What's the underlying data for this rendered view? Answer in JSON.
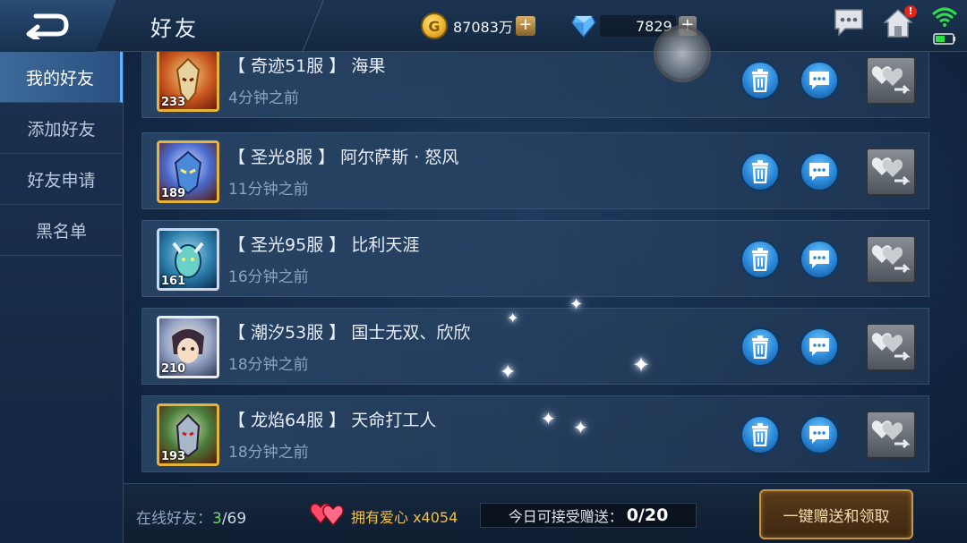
{
  "header": {
    "title": "好友",
    "gold": "87083万",
    "gold_plus": "+",
    "coin_glyph": "G",
    "diamonds": "7829",
    "diamond_plus": "+",
    "notification_badge": "!"
  },
  "sidebar": {
    "items": [
      {
        "label": "我的好友"
      },
      {
        "label": "添加好友"
      },
      {
        "label": "好友申请"
      },
      {
        "label": "黑名单"
      }
    ]
  },
  "friends": [
    {
      "server": "【 奇迹51服 】",
      "name": "海果",
      "time": "4分钟之前",
      "level": "233"
    },
    {
      "server": "【 圣光8服 】",
      "name": "阿尔萨斯 · 怒风",
      "time": "11分钟之前",
      "level": "189"
    },
    {
      "server": "【 圣光95服 】",
      "name": "比利天涯",
      "time": "16分钟之前",
      "level": "161"
    },
    {
      "server": "【 潮汐53服 】",
      "name": "国士无双、欣欣",
      "time": "18分钟之前",
      "level": "210"
    },
    {
      "server": "【 龙焰64服 】",
      "name": "天命打工人",
      "time": "18分钟之前",
      "level": "193"
    }
  ],
  "footer": {
    "online_label": "在线好友：",
    "online_count": "3",
    "online_total": "/69",
    "hearts_label": "拥有爱心 x4054",
    "gift_label": "今日可接受赠送：",
    "gift_count": "0/20",
    "claim_button": "一键赠送和领取"
  },
  "colors": {
    "accent": "#66b2ff",
    "online": "#6bdc5a",
    "hearts": "#f0c24a",
    "gold_border": "#c89640"
  }
}
